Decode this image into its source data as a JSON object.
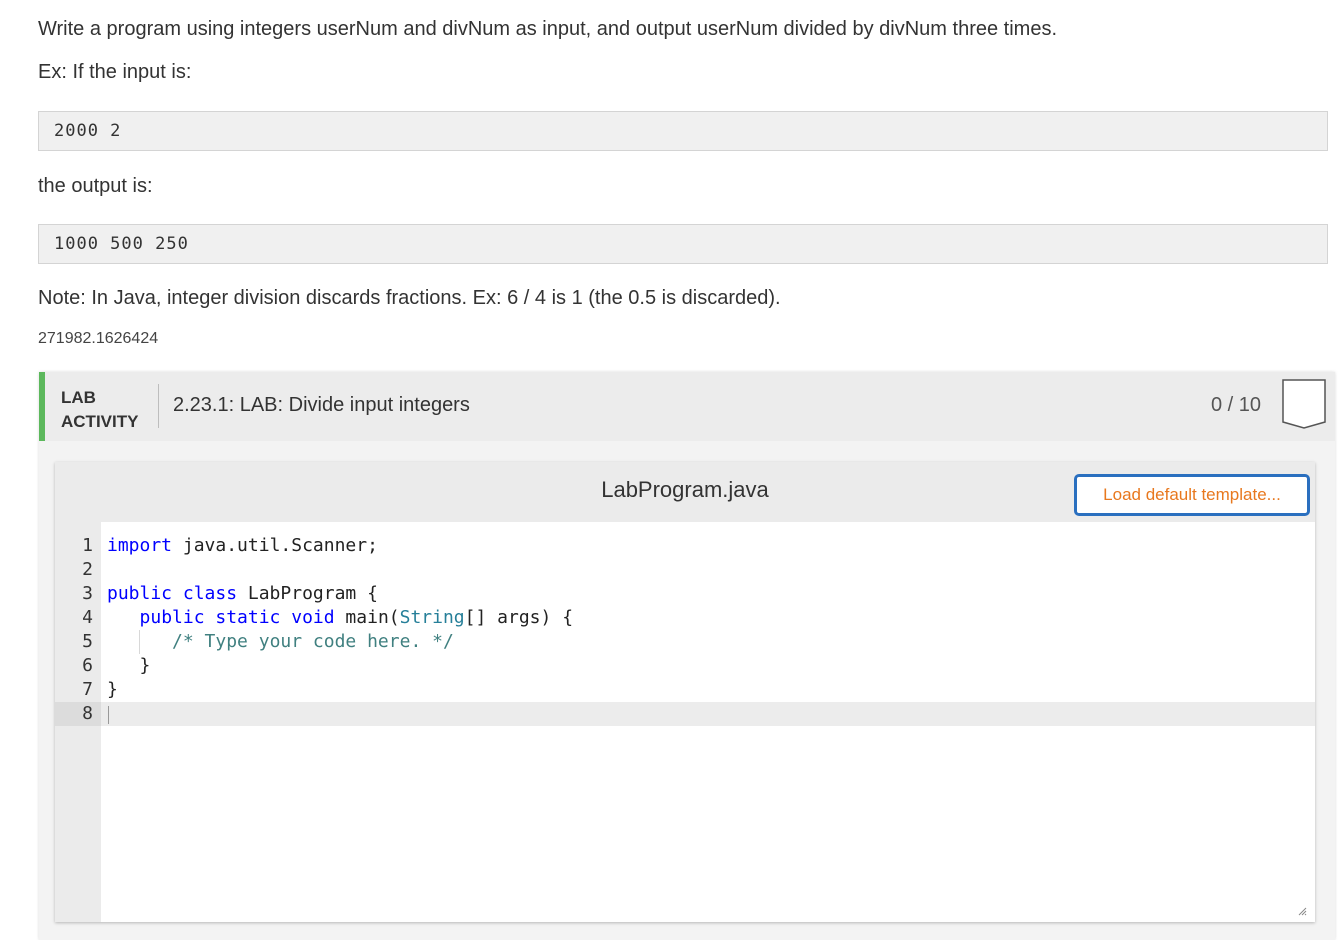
{
  "instructions": {
    "line1": "Write a program using integers userNum and divNum as input, and output userNum divided by divNum three times.",
    "line2": "Ex: If the input is:",
    "sample_input": "2000 2",
    "line3": "the output is:",
    "sample_output": "1000 500 250",
    "note": "Note: In Java, integer division discards fractions. Ex: 6 / 4 is 1 (the 0.5 is discarded).",
    "id": "271982.1626424"
  },
  "lab": {
    "label_line1": "LAB",
    "label_line2": "ACTIVITY",
    "title": "2.23.1: LAB: Divide input integers",
    "score": "0 / 10",
    "accent_color": "#5cb85c"
  },
  "editor": {
    "filename": "LabProgram.java",
    "load_button": "Load default template...",
    "line_numbers": [
      "1",
      "2",
      "3",
      "4",
      "5",
      "6",
      "7",
      "8"
    ],
    "code": {
      "l1_kw": "import",
      "l1_rest": " java.util.Scanner;",
      "l3_kw": "public class",
      "l3_rest": " LabProgram {",
      "l4_indent": "   ",
      "l4_kw": "public static void",
      "l4_mid": " main(",
      "l4_type": "String",
      "l4_rest": "[] args) {",
      "l5_indent": "      ",
      "l5_comment": "/* Type your code here. */",
      "l6": "   }",
      "l7": "}"
    }
  },
  "icons": {
    "badge": "completion-badge-icon",
    "resize": "resize-handle-icon"
  }
}
